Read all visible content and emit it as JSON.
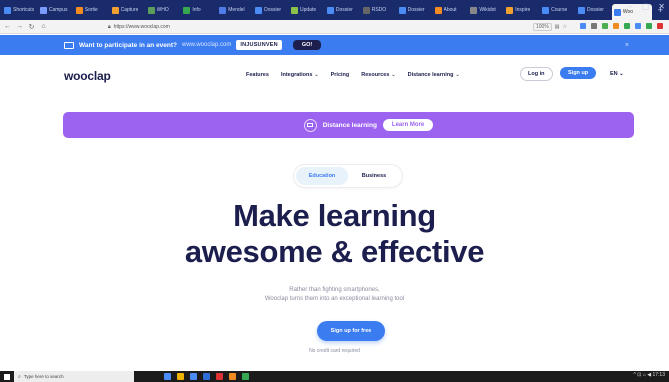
{
  "browser": {
    "tabs": [
      {
        "label": "Shortcuts",
        "color": "#4b8bf5",
        "active": false
      },
      {
        "label": "Campus",
        "color": "#7a9cff",
        "active": false
      },
      {
        "label": "Sortie",
        "color": "#f28b22",
        "active": false
      },
      {
        "label": "Capture",
        "color": "#f0a030",
        "active": false
      },
      {
        "label": "WHO",
        "color": "#5b9e5b",
        "active": false
      },
      {
        "label": "Info",
        "color": "#36a852",
        "active": false
      },
      {
        "label": "Mendel",
        "color": "#4f7ce8",
        "active": false
      },
      {
        "label": "Dossier",
        "color": "#4b8bf5",
        "active": false
      },
      {
        "label": "Update",
        "color": "#8bc34a",
        "active": false
      },
      {
        "label": "Dossier",
        "color": "#4b8bf5",
        "active": false
      },
      {
        "label": "RSDO",
        "color": "#666666",
        "active": false
      },
      {
        "label": "Dossier",
        "color": "#4b8bf5",
        "active": false
      },
      {
        "label": "About",
        "color": "#f28b22",
        "active": false
      },
      {
        "label": "Wikidot",
        "color": "#888888",
        "active": false
      },
      {
        "label": "Inspire",
        "color": "#f2a030",
        "active": false
      },
      {
        "label": "Course",
        "color": "#4b8bf5",
        "active": false
      },
      {
        "label": "Dossier",
        "color": "#4b8bf5",
        "active": false
      },
      {
        "label": "Woo",
        "color": "#3b7cf0",
        "active": true
      }
    ],
    "new_tab": "+",
    "url": "https://www.wooclap.com",
    "zoom": "100%",
    "ext_colors": [
      "#4b8bf5",
      "#777777",
      "#4caf50",
      "#f28b22",
      "#36a852",
      "#4b8bf5",
      "#36a852",
      "#d33"
    ]
  },
  "promo": {
    "text": "Want to participate in an event?",
    "site": "www.wooclap.com",
    "code_button": "INJUSUNVEN",
    "go_button": "GO!",
    "close": "×"
  },
  "nav": {
    "logo": "wooclap",
    "links": [
      {
        "label": "Features",
        "chevron": false
      },
      {
        "label": "Integrations",
        "chevron": true
      },
      {
        "label": "Pricing",
        "chevron": false
      },
      {
        "label": "Resources",
        "chevron": true
      },
      {
        "label": "Distance learning",
        "chevron": true
      }
    ],
    "login": "Log in",
    "signup": "Sign up",
    "language": "EN"
  },
  "distance_banner": {
    "label": "Distance learning",
    "button": "Learn More"
  },
  "toggle": {
    "options": [
      "Education",
      "Business"
    ],
    "selected": "Education"
  },
  "hero": {
    "title_line1": "Make learning",
    "title_line2": "awesome & effective",
    "sub_line1": "Rather than fighting smartphones,",
    "sub_line2": "Wooclap turns them into an exceptional learning tool",
    "cta": "Sign up for free",
    "cta_note": "No credit card required"
  },
  "taskbar": {
    "search_placeholder": "Type here to search",
    "app_colors": [
      "#4b8bf5",
      "#f0b400",
      "#4b8bf5",
      "#2d6fd6",
      "#d33",
      "#f28b22",
      "#36a852"
    ],
    "tray": "^ ⊡ ⌂ ◀ 17:13"
  }
}
